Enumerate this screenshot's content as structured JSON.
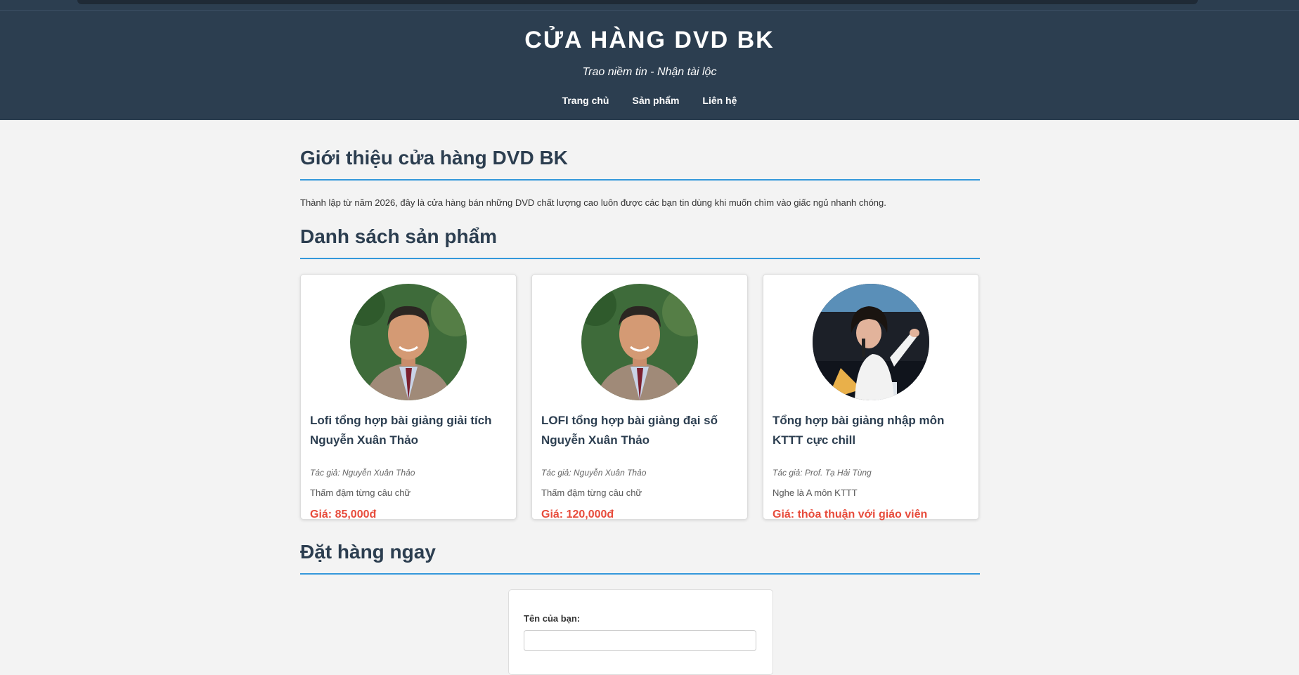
{
  "header": {
    "title": "CỬA HÀNG DVD BK",
    "tagline": "Trao niềm tin - Nhận tài lộc",
    "nav": [
      "Trang chủ",
      "Sản phẩm",
      "Liên hệ"
    ]
  },
  "intro": {
    "heading": "Giới thiệu cửa hàng DVD BK",
    "text": "Thành lập từ năm 2026, đây là cửa hàng bán những DVD chất lượng cao luôn được các bạn tin dùng khi muốn chìm vào giấc ngủ nhanh chóng."
  },
  "products": {
    "heading": "Danh sách sản phẩm",
    "items": [
      {
        "name": "Lofi tổng hợp bài giảng giải tích Nguyễn Xuân Thảo",
        "author": "Tác giả: Nguyễn Xuân Thảo",
        "description": "Thấm đậm từng câu chữ",
        "price": "Giá: 85,000đ"
      },
      {
        "name": "LOFI tổng hợp bài giảng đại số Nguyễn Xuân Thảo",
        "author": "Tác giả: Nguyễn Xuân Thảo",
        "description": "Thấm đậm từng câu chữ",
        "price": "Giá: 120,000đ"
      },
      {
        "name": "Tổng hợp bài giảng nhập môn KTTT cực chill",
        "author": "Tác giả: Prof. Tạ Hải Tùng",
        "description": "Nghe là A môn KTTT",
        "price": "Giá: thỏa thuận với giáo viên"
      }
    ]
  },
  "order": {
    "heading": "Đặt hàng ngay",
    "name_label": "Tên của bạn:",
    "name_value": ""
  },
  "colors": {
    "header_bg": "#2c3e50",
    "accent_line": "#3498db",
    "price": "#e74c3c",
    "page_bg": "#f3f3f3"
  }
}
